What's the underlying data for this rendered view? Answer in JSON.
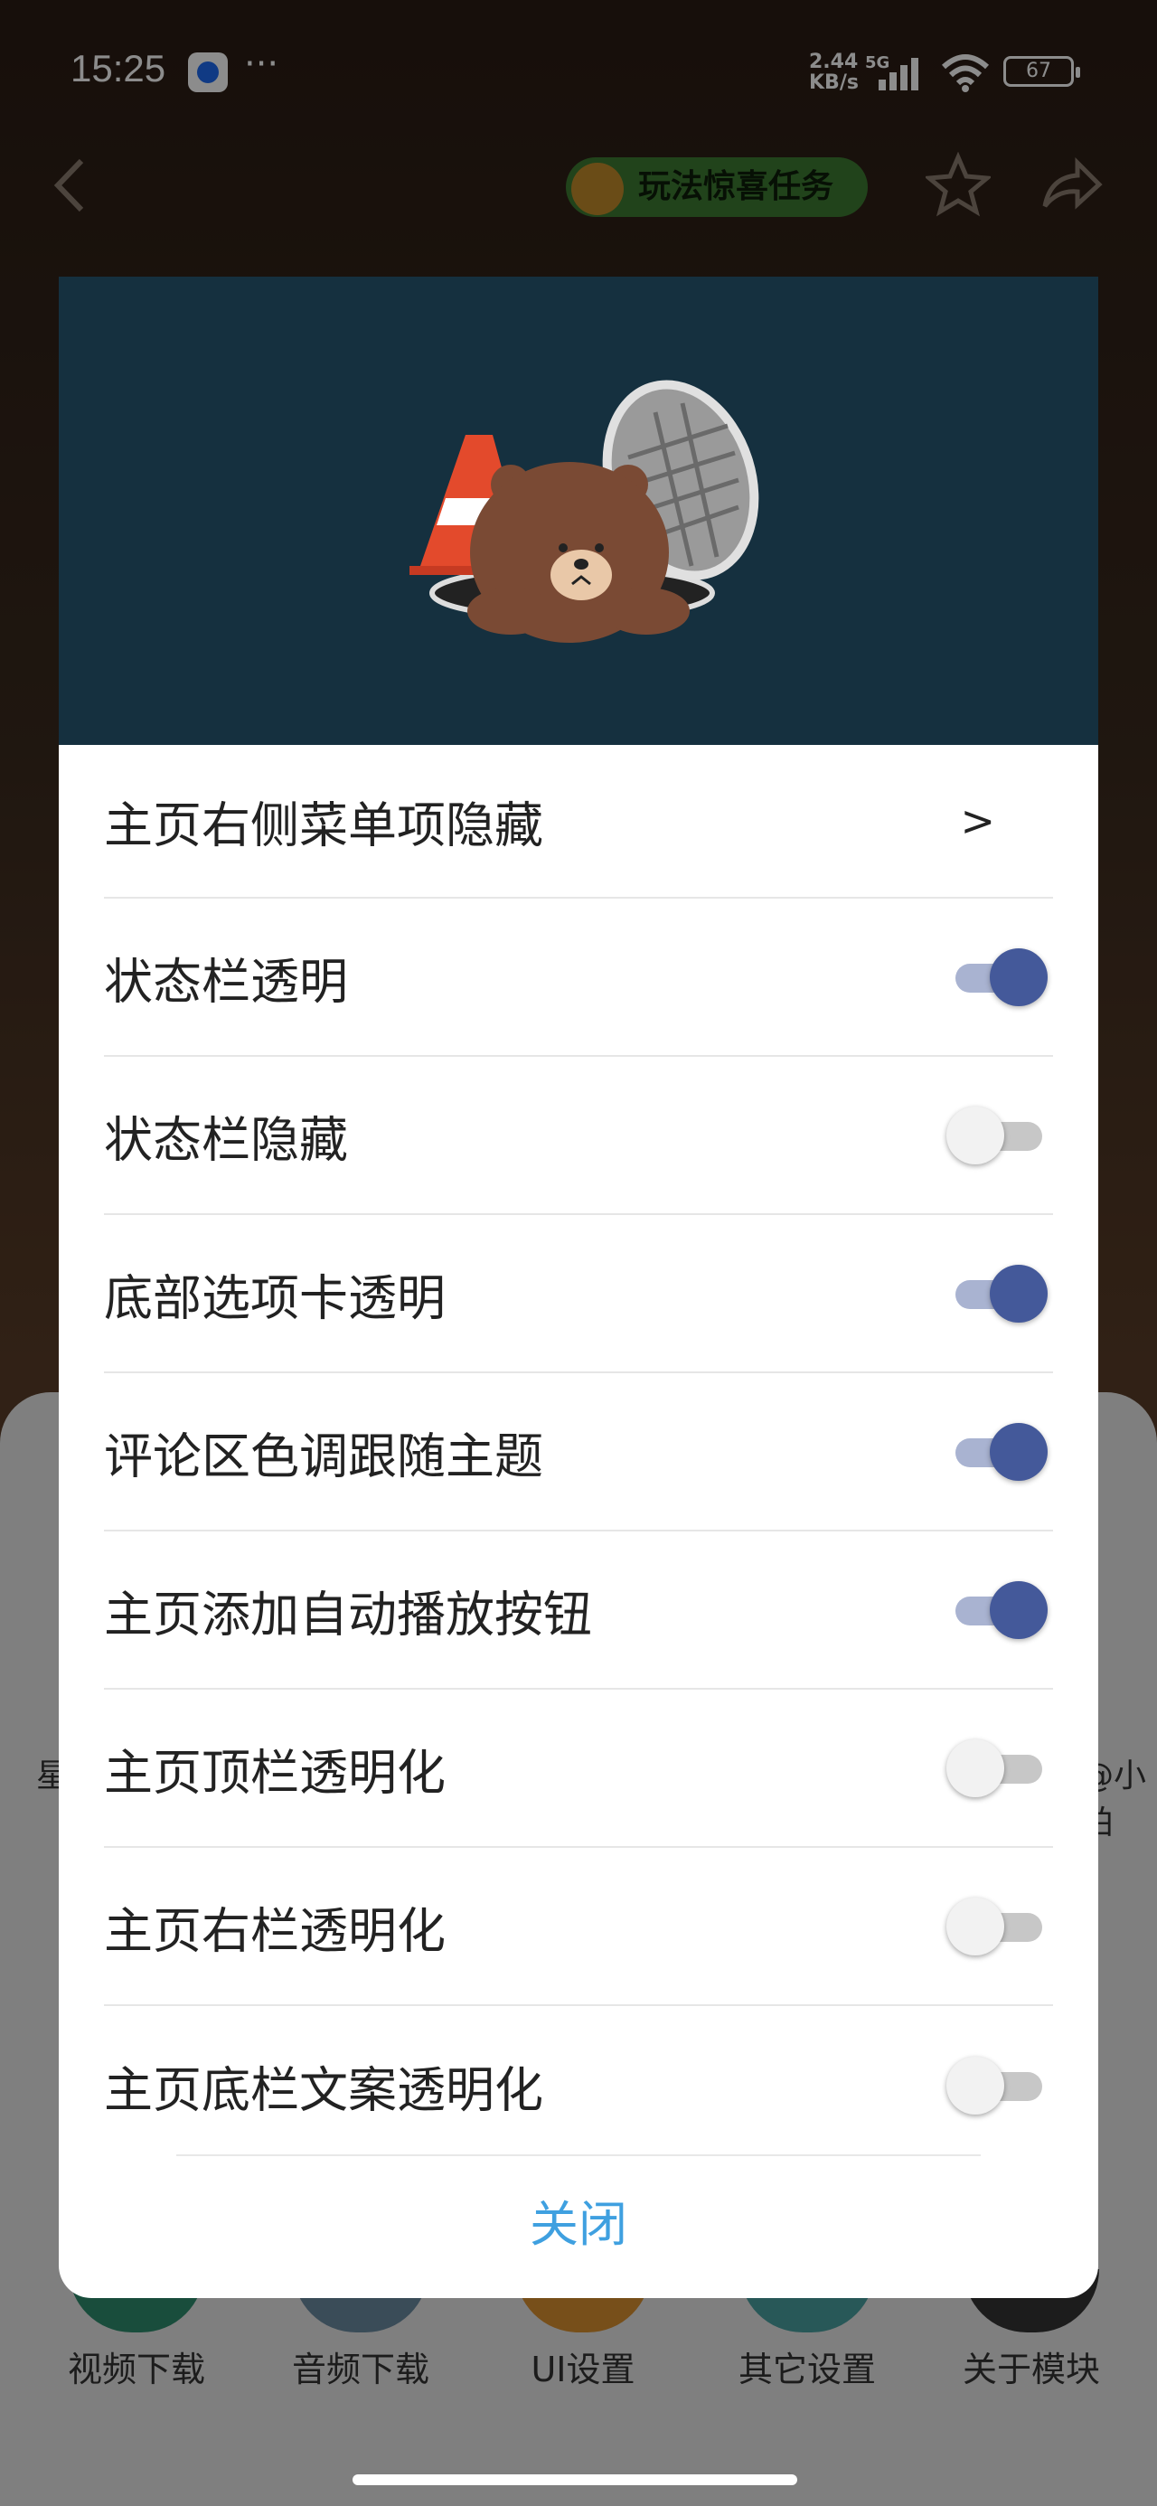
{
  "status_bar": {
    "time": "15:25",
    "net_speed": "2.44",
    "net_unit": "KB/s",
    "net_type": "5G",
    "battery": "67",
    "more": "···"
  },
  "topnav": {
    "promo_label": "玩法惊喜任务",
    "promo_color": "#3d7a32"
  },
  "dialog": {
    "header_image": "brown-bear-manhole-illustration",
    "rows": [
      {
        "label": "主页右侧菜单项隐藏",
        "control": "chevron",
        "chevron": ">"
      },
      {
        "label": "状态栏透明",
        "control": "toggle",
        "on": true
      },
      {
        "label": "状态栏隐藏",
        "control": "toggle",
        "on": false
      },
      {
        "label": "底部选项卡透明",
        "control": "toggle",
        "on": true
      },
      {
        "label": "评论区色调跟随主题",
        "control": "toggle",
        "on": true
      },
      {
        "label": "主页添加自动播放按钮",
        "control": "toggle",
        "on": true
      },
      {
        "label": "主页顶栏透明化",
        "control": "toggle",
        "on": false
      },
      {
        "label": "主页右栏透明化",
        "control": "toggle",
        "on": false
      },
      {
        "label": "主页底栏文案透明化",
        "control": "toggle",
        "on": false
      }
    ],
    "close_label": "关闭",
    "accent_color": "#3fa0e0",
    "toggle_on_color": "#44599a"
  },
  "background": {
    "bottom_items": [
      "视频下载",
      "音频下载",
      "UI设置",
      "其它设置",
      "关于模块"
    ],
    "side_left": "星",
    "side_right": "@小柏"
  }
}
